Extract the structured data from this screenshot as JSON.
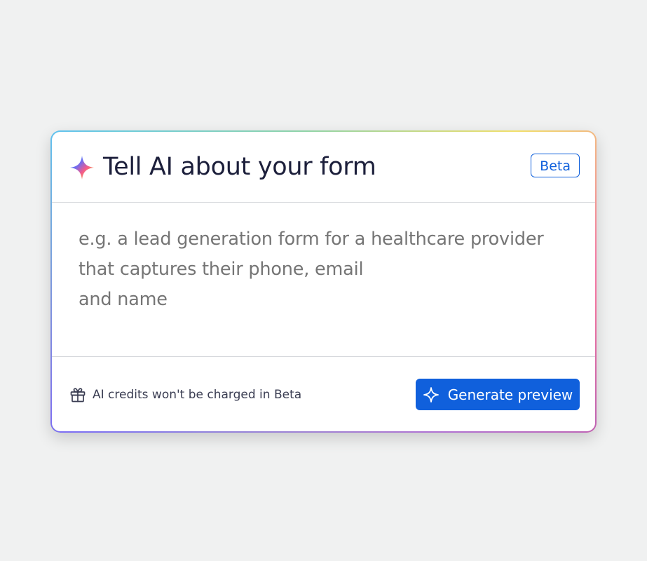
{
  "card": {
    "title": "Tell AI about your form",
    "badge": "Beta",
    "prompt_placeholder": "e.g. a lead generation form for a healthcare provider\nthat captures their phone, email\nand name",
    "prompt_value": "",
    "credits_note": "AI credits won't be charged in Beta",
    "generate_label": "Generate preview"
  },
  "icons": {
    "title_icon": "ai-sparkle-icon",
    "footer_icon": "gift-icon",
    "button_icon": "sparkle-icon"
  },
  "colors": {
    "accent": "#1060dc",
    "title_text": "#1c1f3b",
    "placeholder_text": "#5b5e73",
    "page_background": "#f0f1f1"
  }
}
